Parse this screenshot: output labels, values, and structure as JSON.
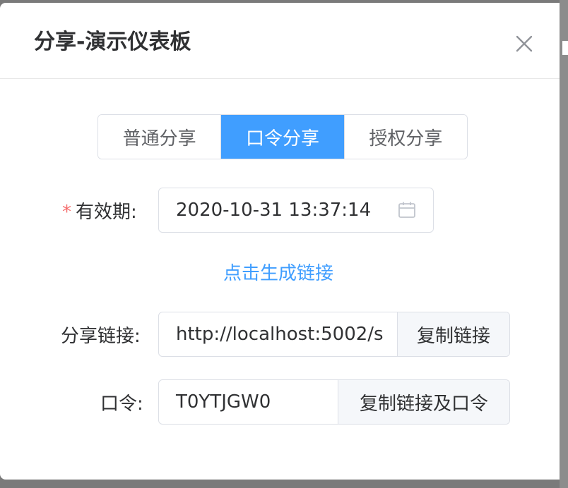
{
  "dialog": {
    "title": "分享-演示仪表板",
    "close_icon": "close-icon"
  },
  "tabs": [
    {
      "label": "普通分享",
      "active": false
    },
    {
      "label": "口令分享",
      "active": true
    },
    {
      "label": "授权分享",
      "active": false
    }
  ],
  "form": {
    "expiry": {
      "required_mark": "*",
      "label": "有效期:",
      "value": "2020-10-31 13:37:14",
      "icon": "calendar-icon"
    },
    "generate_link": "点击生成链接",
    "share_link": {
      "label": "分享链接:",
      "value": "http://localhost:5002/s",
      "button": "复制链接"
    },
    "password": {
      "label": "口令:",
      "value": "T0YTJGW0",
      "button": "复制链接及口令"
    }
  },
  "colors": {
    "accent": "#409eff",
    "required": "#f56c6c",
    "border": "#dcdfe6",
    "text": "#303133"
  }
}
